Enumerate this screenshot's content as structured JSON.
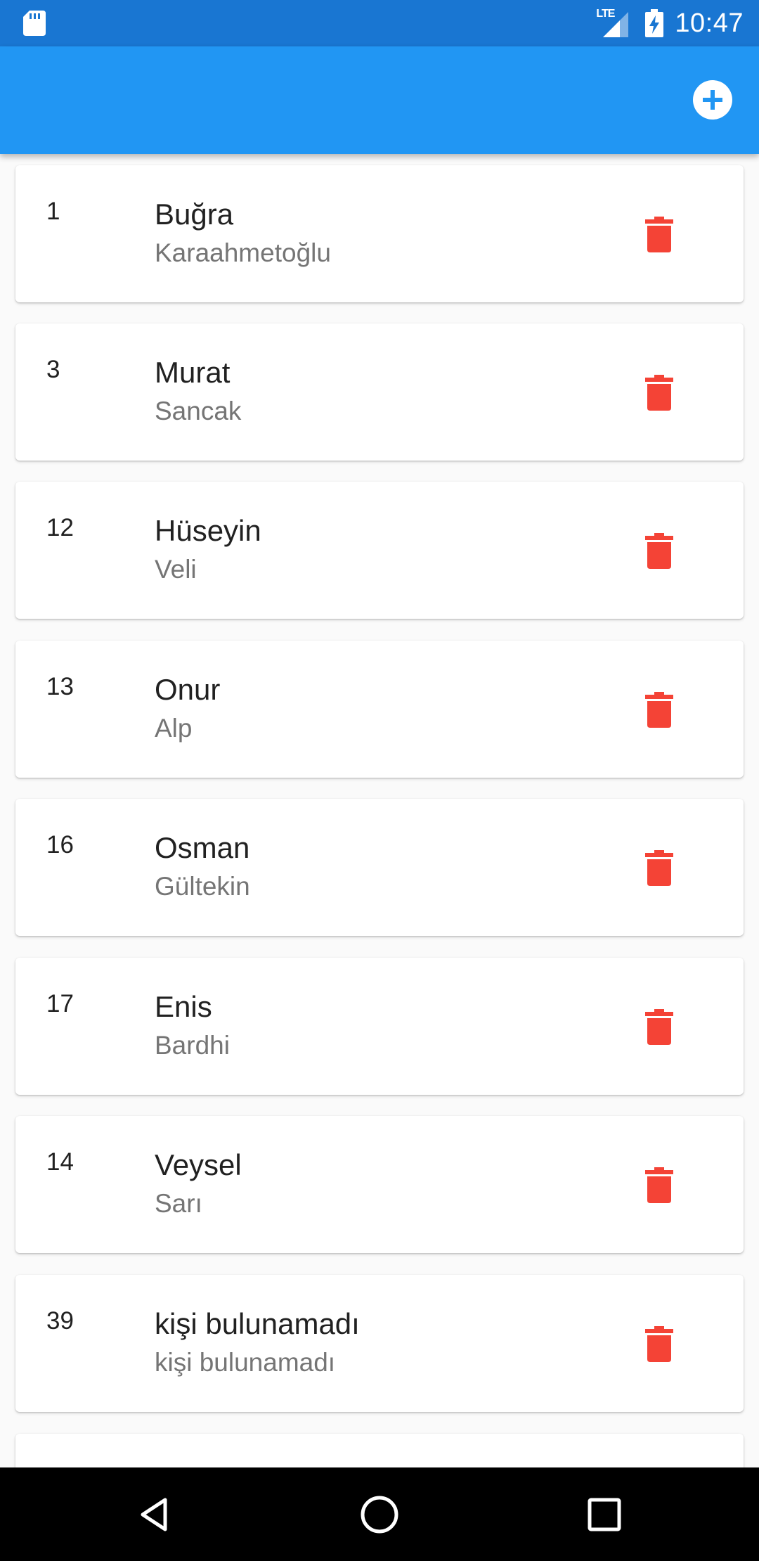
{
  "status_bar": {
    "time": "10:47",
    "network": "LTE",
    "icons": [
      "sd-card-icon",
      "signal-icon",
      "battery-charging-icon"
    ]
  },
  "app_bar": {
    "add_icon": "add-circle-icon",
    "color": "#2196f3"
  },
  "people": [
    {
      "id": "1",
      "name": "Buğra",
      "surname": "Karaahmetoğlu"
    },
    {
      "id": "3",
      "name": "Murat",
      "surname": "Sancak"
    },
    {
      "id": "12",
      "name": "Hüseyin",
      "surname": "Veli"
    },
    {
      "id": "13",
      "name": "Onur",
      "surname": "Alp"
    },
    {
      "id": "16",
      "name": "Osman",
      "surname": "Gültekin"
    },
    {
      "id": "17",
      "name": "Enis",
      "surname": "Bardhi"
    },
    {
      "id": "14",
      "name": "Veysel",
      "surname": "Sarı"
    },
    {
      "id": "39",
      "name": "kişi bulunamadı",
      "surname": "kişi bulunamadı"
    }
  ],
  "delete_icon": "trash-icon",
  "delete_color": "#f44336",
  "nav_bar": {
    "icons": [
      "back-icon",
      "home-icon",
      "recents-icon"
    ]
  }
}
